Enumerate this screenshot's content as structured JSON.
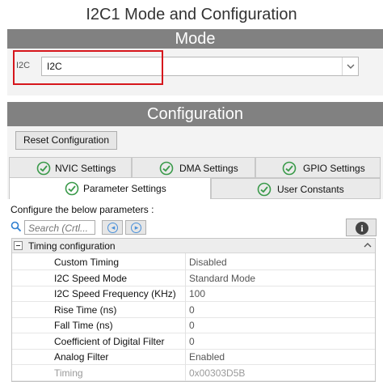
{
  "window": {
    "title": "I2C1 Mode and Configuration"
  },
  "mode": {
    "header": "Mode",
    "field_label": "I2C",
    "selected_value": "I2C"
  },
  "configuration": {
    "header": "Configuration",
    "reset_label": "Reset Configuration",
    "tabs": [
      {
        "label": "NVIC Settings",
        "checked": true,
        "active": false
      },
      {
        "label": "DMA Settings",
        "checked": true,
        "active": false
      },
      {
        "label": "GPIO Settings",
        "checked": true,
        "active": false
      },
      {
        "label": "Parameter Settings",
        "checked": true,
        "active": true
      },
      {
        "label": "User Constants",
        "checked": true,
        "active": false
      }
    ],
    "caption": "Configure the below parameters :",
    "search_placeholder": "Search (Crtl...",
    "group_label": "Timing configuration",
    "parameters": [
      {
        "name": "Custom Timing",
        "value": "Disabled"
      },
      {
        "name": "I2C Speed Mode",
        "value": "Standard Mode"
      },
      {
        "name": "I2C Speed Frequency (KHz)",
        "value": "100"
      },
      {
        "name": "Rise Time (ns)",
        "value": "0"
      },
      {
        "name": "Fall Time (ns)",
        "value": "0"
      },
      {
        "name": "Coefficient of Digital Filter",
        "value": "0"
      },
      {
        "name": "Analog Filter",
        "value": "Enabled"
      },
      {
        "name": "Timing",
        "value": "0x00303D5B"
      }
    ]
  },
  "colors": {
    "header_bg": "#818181",
    "highlight": "#d6161c",
    "check_green": "#3a9a4a",
    "nav_blue": "#4a90d9"
  }
}
